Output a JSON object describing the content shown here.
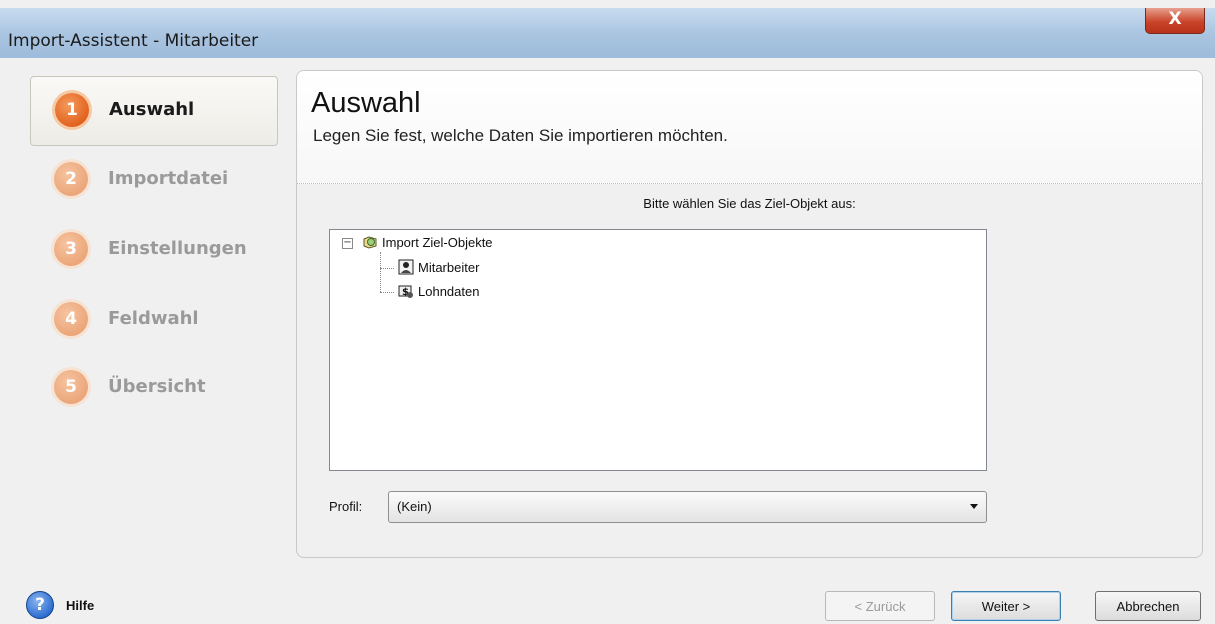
{
  "window": {
    "title": "Import-Assistent - Mitarbeiter",
    "close_glyph": "X"
  },
  "steps": [
    {
      "number": "1",
      "label": "Auswahl",
      "active": true
    },
    {
      "number": "2",
      "label": "Importdatei",
      "active": false
    },
    {
      "number": "3",
      "label": "Einstellungen",
      "active": false
    },
    {
      "number": "4",
      "label": "Feldwahl",
      "active": false
    },
    {
      "number": "5",
      "label": "Übersicht",
      "active": false
    }
  ],
  "main": {
    "title": "Auswahl",
    "subtitle": "Legen Sie fest, welche Daten Sie importieren möchten.",
    "prompt": "Bitte wählen Sie das Ziel-Objekt aus:",
    "tree": {
      "expander": "−",
      "root": "Import Ziel-Objekte",
      "children": [
        "Mitarbeiter",
        "Lohndaten"
      ]
    },
    "profile_label": "Profil:",
    "profile_value": "(Kein)"
  },
  "footer": {
    "help_glyph": "?",
    "help_label": "Hilfe",
    "back_label": "< Zurück",
    "next_label": "Weiter >",
    "cancel_label": "Abbrechen"
  },
  "colors": {
    "accent": "#e2631f",
    "titlebar": "#a9c4e0",
    "close": "#c9452a"
  }
}
